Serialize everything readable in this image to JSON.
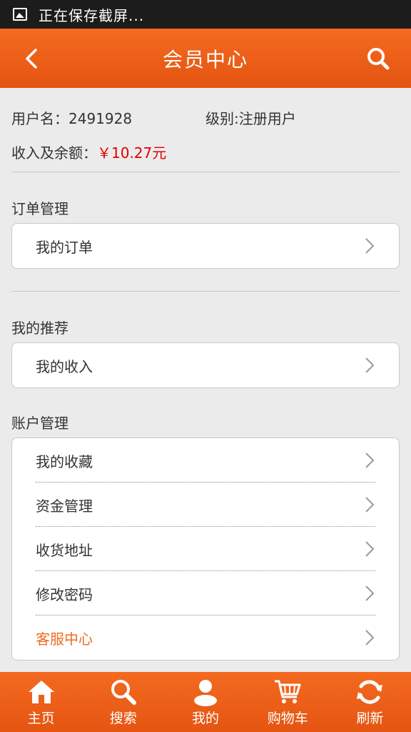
{
  "status_bar": {
    "text": "正在保存截屏..."
  },
  "header": {
    "title": "会员中心"
  },
  "user": {
    "username_label": "用户名：",
    "username": "2491928",
    "level_label": "级别:",
    "level": "注册用户",
    "balance_label": "收入及余额：",
    "balance": "￥10.27元"
  },
  "sections": {
    "orders": {
      "title": "订单管理",
      "items": [
        "我的订单"
      ]
    },
    "recommend": {
      "title": "我的推荐",
      "items": [
        "我的收入"
      ]
    },
    "account": {
      "title": "账户管理",
      "items": [
        "我的收藏",
        "资金管理",
        "收货地址",
        "修改密码",
        "客服中心"
      ]
    }
  },
  "tabs": [
    {
      "label": "主页",
      "icon": "home-icon"
    },
    {
      "label": "搜索",
      "icon": "search-icon"
    },
    {
      "label": "我的",
      "icon": "user-icon"
    },
    {
      "label": "购物车",
      "icon": "cart-icon"
    },
    {
      "label": "刷新",
      "icon": "refresh-icon"
    }
  ],
  "colors": {
    "accent": "#ef6b22",
    "money": "#e10000",
    "background": "#ebebeb"
  }
}
